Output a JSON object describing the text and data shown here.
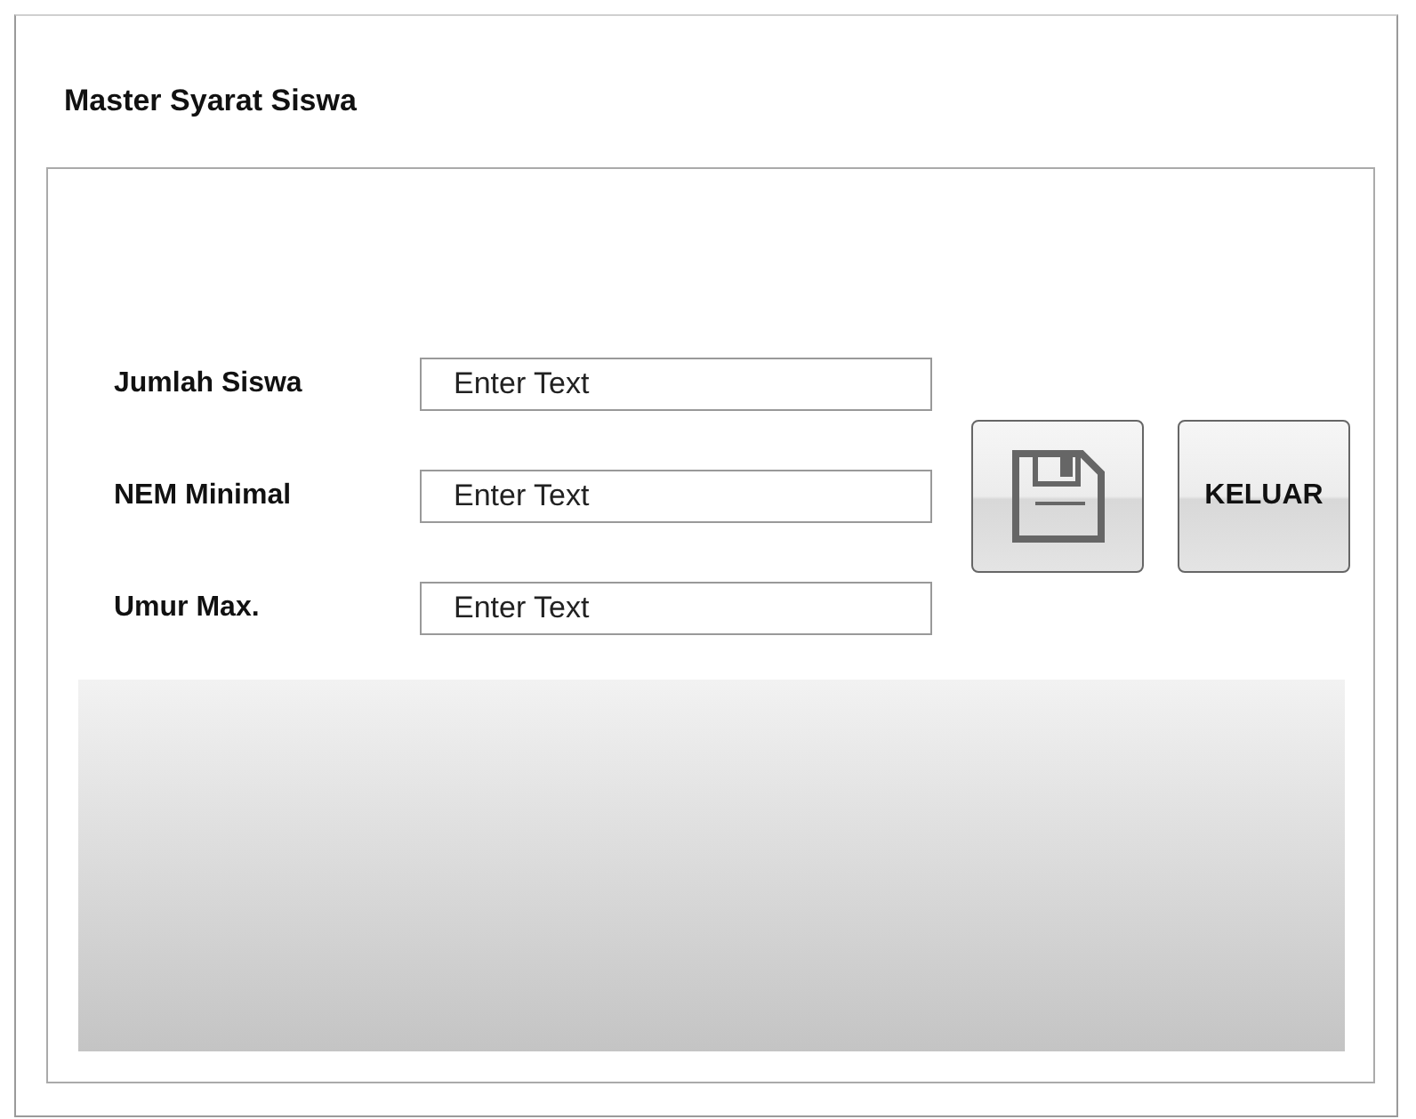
{
  "window": {
    "title": "Master Syarat Siswa"
  },
  "fields": [
    {
      "label": "Jumlah Siswa",
      "placeholder": "Enter Text"
    },
    {
      "label": "NEM Minimal",
      "placeholder": "Enter Text"
    },
    {
      "label": "Umur Max.",
      "placeholder": "Enter Text"
    }
  ],
  "buttons": [
    {
      "kind": "icon"
    },
    {
      "kind": "text",
      "label": "KELUAR"
    }
  ],
  "table": {
    "kind": "empty-grid"
  }
}
